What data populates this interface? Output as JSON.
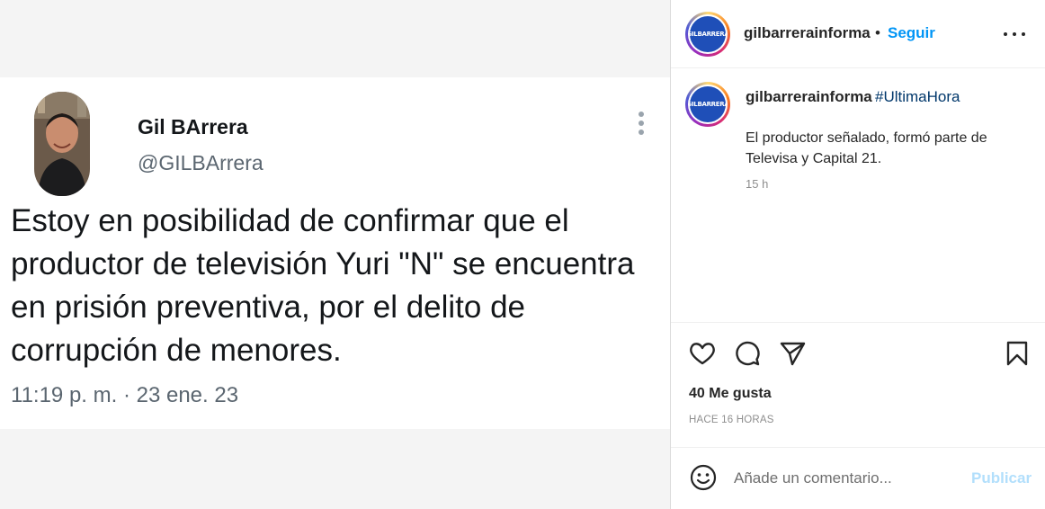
{
  "tweet": {
    "name": "Gil BArrera",
    "handle": "@GILBArrera",
    "text": "Estoy en posibilidad de confirmar que el productor de televisión  Yuri \"N\" se encuentra en prisión preventiva, por el delito de corrupción de menores.",
    "timestamp": "11:19 p. m. · 23 ene. 23"
  },
  "post": {
    "username": "gilbarrerainforma",
    "separator": "•",
    "follow_label": "Seguir",
    "logo_text": "GILBARRERA"
  },
  "caption": {
    "username": "gilbarrerainforma",
    "hashtag": "#UltimaHora",
    "text": "El productor señalado, formó parte de Televisa y Capital 21.",
    "time": "15 h"
  },
  "engagement": {
    "likes": "40 Me gusta",
    "posted_ago": "HACE 16 HORAS"
  },
  "comment": {
    "placeholder": "Añade un comentario...",
    "publish_label": "Publicar"
  },
  "colors": {
    "accent": "#0095f6",
    "publish_disabled": "#b2dffc",
    "hashtag": "#00376b",
    "logo_blue": "#1f4fb8"
  },
  "icons": [
    "heart-icon",
    "comment-icon",
    "share-icon",
    "bookmark-icon",
    "emoji-icon",
    "more-icon"
  ]
}
